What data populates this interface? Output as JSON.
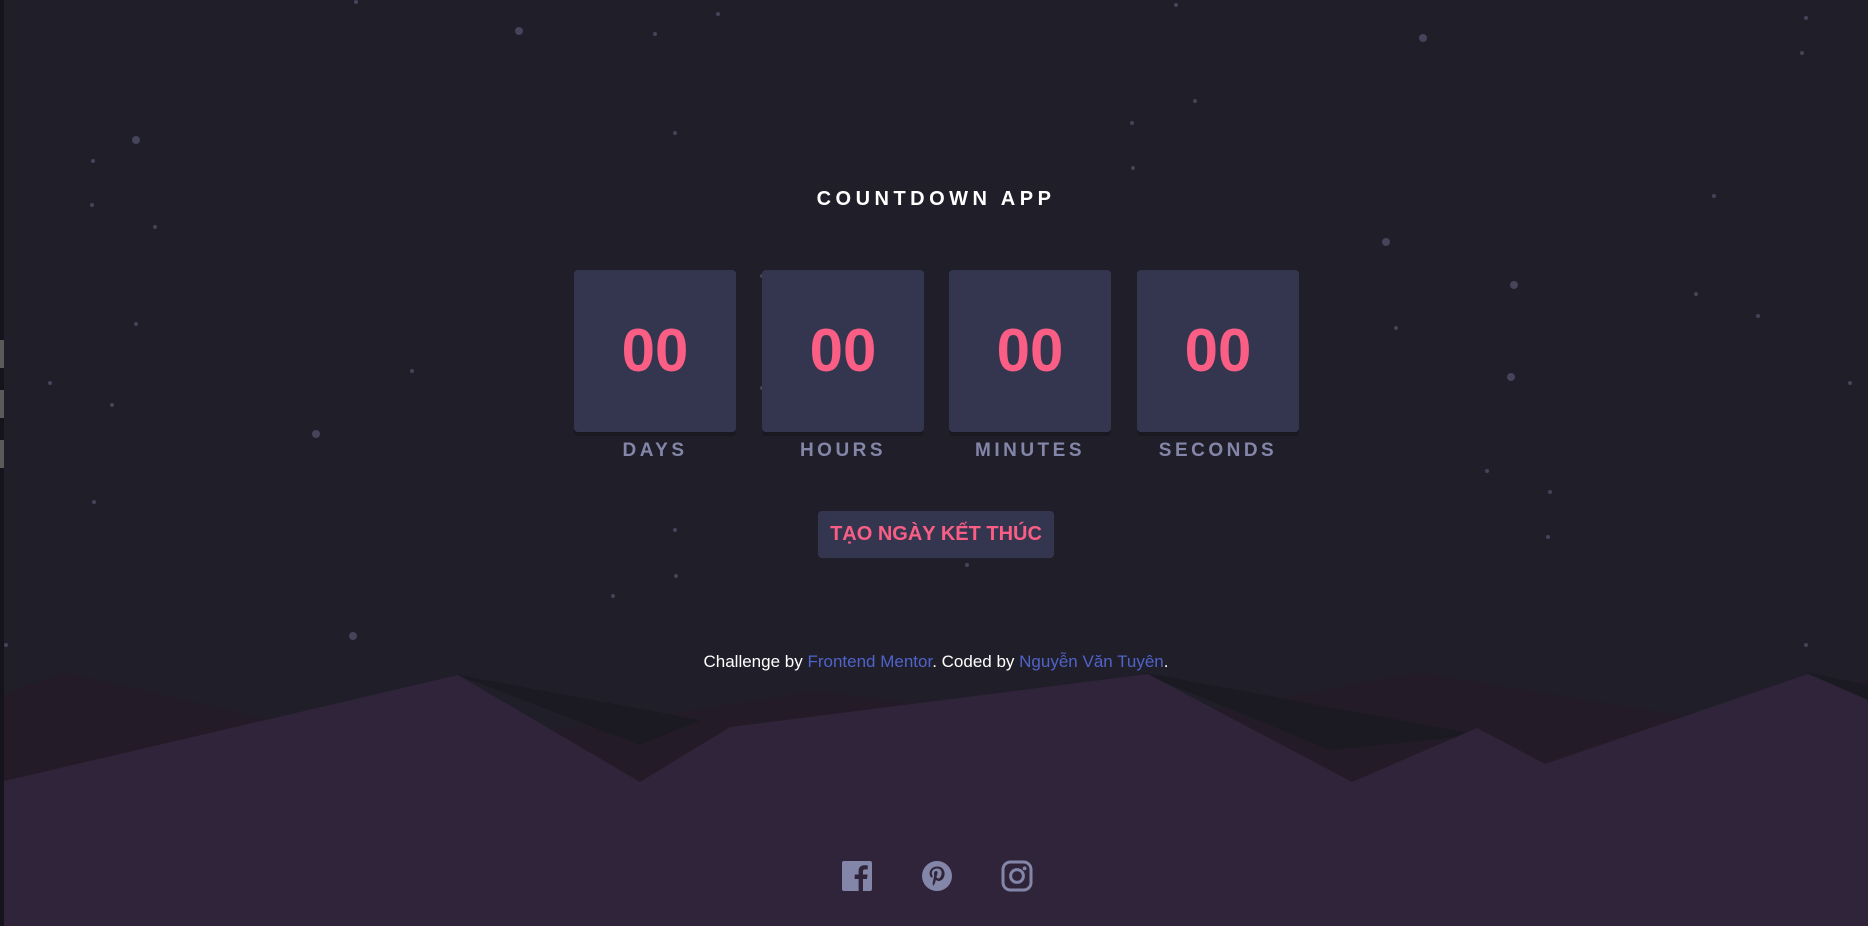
{
  "app": {
    "title": "COUNTDOWN APP"
  },
  "countdown": [
    {
      "value": "00",
      "label": "DAYS"
    },
    {
      "value": "00",
      "label": "HOURS"
    },
    {
      "value": "00",
      "label": "MINUTES"
    },
    {
      "value": "00",
      "label": "SECONDS"
    }
  ],
  "action_button": {
    "label": "TẠO NGÀY KẾT THÚC"
  },
  "attribution": {
    "prefix": "Challenge by ",
    "link1": "Frontend Mentor",
    "middle": ". Coded by ",
    "link2": "Nguyễn Văn Tuyên",
    "suffix": "."
  },
  "social": [
    "facebook-icon",
    "pinterest-icon",
    "instagram-icon"
  ],
  "colors": {
    "background": "#1f1e29",
    "card": "#343650",
    "accent": "#fb5e84",
    "label": "#8486a9",
    "link": "#5063c9",
    "hills": "#2f2439",
    "icon": "#8486a9"
  }
}
